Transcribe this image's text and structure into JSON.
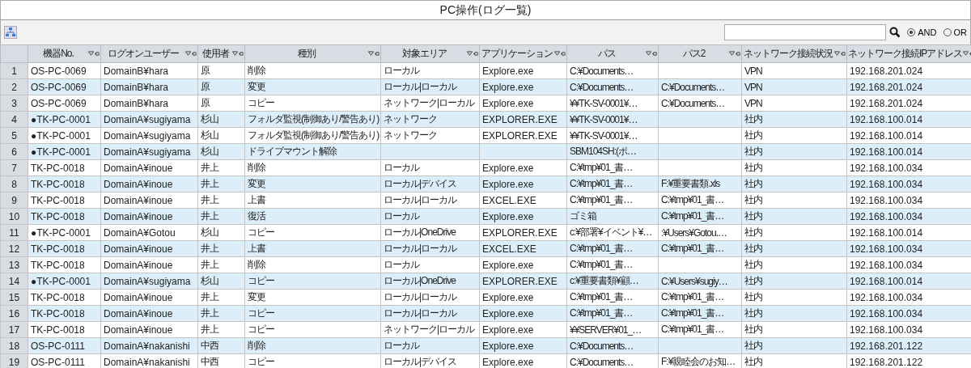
{
  "window": {
    "title": "PC操作(ログ一覧)"
  },
  "search_mode": [
    {
      "label": "AND",
      "selected": true
    },
    {
      "label": "OR",
      "selected": false
    }
  ],
  "table": {
    "columns": [
      {
        "label": "機器No."
      },
      {
        "label": "ログオンユーザー"
      },
      {
        "label": "使用者"
      },
      {
        "label": "種別"
      },
      {
        "label": "対象エリア"
      },
      {
        "label": "アプリケーション"
      },
      {
        "label": "パス"
      },
      {
        "label": "パス2"
      },
      {
        "label": "ネットワーク接続状況"
      },
      {
        "label": "ネットワーク接続IPアドレス"
      }
    ],
    "rows": [
      {
        "number": "1",
        "device_no": "OS-PC-0069",
        "logon_user": "DomainB¥hara",
        "user": "原",
        "type": "削除",
        "target_area": "ローカル",
        "application": "Explore.exe",
        "path": "C:¥Documents…",
        "network_status": "VPN",
        "ip_address": "192.168.201.024"
      },
      {
        "number": "2",
        "device_no": "OS-PC-0069",
        "logon_user": "DomainB¥hara",
        "user": "原",
        "type": "変更",
        "target_area": "ローカル|ローカル",
        "application": "Explore.exe",
        "path": "C:¥Documents…",
        "path2": "C:¥Documents…",
        "network_status": "VPN",
        "ip_address": "192.168.201.024"
      },
      {
        "number": "3",
        "device_no": "OS-PC-0069",
        "logon_user": "DomainB¥hara",
        "user": "原",
        "type": "コピー",
        "target_area": "ネットワーク|ローカル",
        "application": "Explore.exe",
        "path": "¥¥TK-SV-0001¥…",
        "path2": "C:¥Documents…",
        "network_status": "VPN",
        "ip_address": "192.168.201.024"
      },
      {
        "number": "4",
        "device_no": "●TK-PC-0001",
        "logon_user": "DomainA¥sugiyama",
        "user": "杉山",
        "type": "フォルダ監視(制御あり/警告あり)",
        "target_area": "ネットワーク",
        "application": "EXPLORER.EXE",
        "path": "¥¥TK-SV-0001¥…",
        "network_status": "社内",
        "ip_address": "192.168.100.014"
      },
      {
        "number": "5",
        "device_no": "●TK-PC-0001",
        "logon_user": "DomainA¥sugiyama",
        "user": "杉山",
        "type": "フォルダ監視(制御あり/警告あり)",
        "target_area": "ネットワーク",
        "application": "EXPLORER.EXE",
        "path": "¥¥TK-SV-0001¥…",
        "network_status": "社内",
        "ip_address": "192.168.100.014"
      },
      {
        "number": "6",
        "device_no": "●TK-PC-0001",
        "logon_user": "DomainA¥sugiyama",
        "user": "杉山",
        "type": "ドライブマウント解除",
        "path": "SBM104SH:(ポ…",
        "network_status": "社内",
        "ip_address": "192.168.100.014"
      },
      {
        "number": "7",
        "device_no": "TK-PC-0018",
        "logon_user": "DomainA¥inoue",
        "user": "井上",
        "type": "削除",
        "target_area": "ローカル",
        "application": "Explore.exe",
        "path": "C:¥tmp¥01_書…",
        "network_status": "社内",
        "ip_address": "192.168.100.034"
      },
      {
        "number": "8",
        "device_no": "TK-PC-0018",
        "logon_user": "DomainA¥inoue",
        "user": "井上",
        "type": "変更",
        "target_area": "ローカル|デバイス",
        "application": "Explore.exe",
        "path": "C:¥tmp¥01_書…",
        "path2": "F:¥重要書類.xls",
        "network_status": "社内",
        "ip_address": "192.168.100.034"
      },
      {
        "number": "9",
        "device_no": "TK-PC-0018",
        "logon_user": "DomainA¥inoue",
        "user": "井上",
        "type": "上書",
        "target_area": "ローカル|ローカル",
        "application": "EXCEL.EXE",
        "path": "C:¥tmp¥01_書…",
        "path2": "C:¥tmp¥01_書…",
        "network_status": "社内",
        "ip_address": "192.168.100.034"
      },
      {
        "number": "10",
        "device_no": "TK-PC-0018",
        "logon_user": "DomainA¥inoue",
        "user": "井上",
        "type": "復活",
        "target_area": "ローカル",
        "application": "Explore.exe",
        "path": "ゴミ箱",
        "path2": "C:¥tmp¥01_書…",
        "network_status": "社内",
        "ip_address": "192.168.100.034"
      },
      {
        "number": "11",
        "device_no": "●TK-PC-0001",
        "logon_user": "DomainA¥Gotou",
        "user": "杉山",
        "type": "コピー",
        "target_area": "ローカル|OneDrive",
        "application": "EXPLORER.EXE",
        "path": "c:¥部署¥イベント¥…",
        "path2": ":¥Users¥Gotou.…",
        "network_status": "社内",
        "ip_address": "192.168.100.014"
      },
      {
        "number": "12",
        "device_no": "TK-PC-0018",
        "logon_user": "DomainA¥inoue",
        "user": "井上",
        "type": "上書",
        "target_area": "ローカル|ローカル",
        "application": "EXCEL.EXE",
        "path": "C:¥tmp¥01_書…",
        "path2": "C:¥tmp¥01_書…",
        "network_status": "社内",
        "ip_address": "192.168.100.034"
      },
      {
        "number": "13",
        "device_no": "TK-PC-0018",
        "logon_user": "DomainA¥inoue",
        "user": "井上",
        "type": "削除",
        "target_area": "ローカル",
        "application": "Explore.exe",
        "path": "C:¥tmp¥01_書…",
        "network_status": "社内",
        "ip_address": "192.168.100.034"
      },
      {
        "number": "14",
        "device_no": "●TK-PC-0001",
        "logon_user": "DomainA¥sugiyama",
        "user": "杉山",
        "type": "コピー",
        "target_area": "ローカル|OneDrive",
        "application": "EXPLORER.EXE",
        "path": "c:¥重要書類¥顧…",
        "path2": "C:¥Users¥sugiy…",
        "network_status": "社内",
        "ip_address": "192.168.100.014"
      },
      {
        "number": "15",
        "device_no": "TK-PC-0018",
        "logon_user": "DomainA¥inoue",
        "user": "井上",
        "type": "変更",
        "target_area": "ローカル|ローカル",
        "application": "Explore.exe",
        "path": "C:¥tmp¥01_書…",
        "path2": "C:¥tmp¥01_書…",
        "network_status": "社内",
        "ip_address": "192.168.100.034"
      },
      {
        "number": "16",
        "device_no": "TK-PC-0018",
        "logon_user": "DomainA¥inoue",
        "user": "井上",
        "type": "コピー",
        "target_area": "ローカル|ローカル",
        "application": "Explore.exe",
        "path": "C:¥tmp¥01_書…",
        "path2": "C:¥tmp¥01_書…",
        "network_status": "社内",
        "ip_address": "192.168.100.034"
      },
      {
        "number": "17",
        "device_no": "TK-PC-0018",
        "logon_user": "DomainA¥inoue",
        "user": "井上",
        "type": "コピー",
        "target_area": "ネットワーク|ローカル",
        "application": "Explore.exe",
        "path": "¥¥SERVER¥01_…",
        "path2": "C:¥tmp¥01_書…",
        "network_status": "社内",
        "ip_address": "192.168.100.034"
      },
      {
        "number": "18",
        "device_no": "OS-PC-0111",
        "logon_user": "DomainA¥nakanishi",
        "user": "中西",
        "type": "削除",
        "target_area": "ローカル",
        "application": "Explore.exe",
        "path": "C:¥Documents…",
        "network_status": "社内",
        "ip_address": "192.168.201.122"
      },
      {
        "number": "19",
        "device_no": "OS-PC-0111",
        "logon_user": "DomainA¥nakanishi",
        "user": "中西",
        "type": "コピー",
        "target_area": "ローカル|デバイス",
        "application": "Explore.exe",
        "path": "C:¥Documents…",
        "path2": "F:¥親睦会のお知…",
        "network_status": "社内",
        "ip_address": "192.168.201.122"
      }
    ]
  }
}
